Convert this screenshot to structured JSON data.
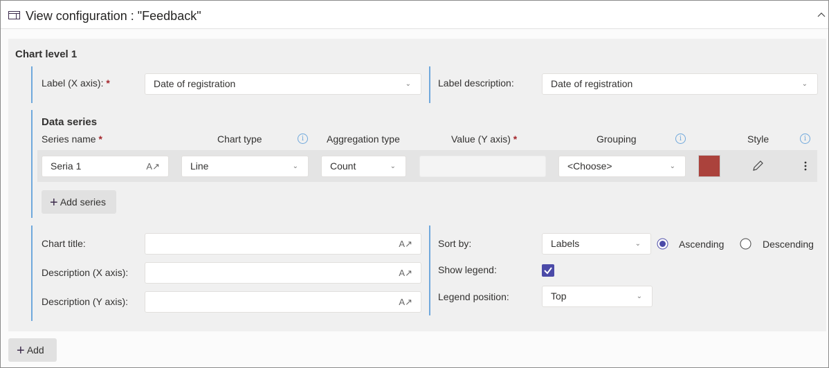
{
  "header": {
    "title": "View configuration : \"Feedback\"",
    "icon": "panel-icon",
    "collapse_icon": "chevron-up-icon"
  },
  "level": {
    "title": "Chart level 1",
    "label_x": {
      "label": "Label (X axis):",
      "required": "*",
      "value": "Date of registration"
    },
    "label_desc": {
      "label": "Label description:",
      "value": "Date of registration"
    }
  },
  "series": {
    "title": "Data series",
    "headers": {
      "name": "Series name",
      "chart_type": "Chart type",
      "aggregation": "Aggregation type",
      "value": "Value (Y axis)",
      "grouping": "Grouping",
      "style": "Style",
      "required": "*"
    },
    "rows": [
      {
        "name": "Seria 1",
        "chart_type": "Line",
        "aggregation": "Count",
        "value": "",
        "grouping": "<Choose>",
        "color": "#ab423c"
      }
    ],
    "add_label": "Add series"
  },
  "options": {
    "chart_title": {
      "label": "Chart title:",
      "value": ""
    },
    "desc_x": {
      "label": "Description (X axis):",
      "value": ""
    },
    "desc_y": {
      "label": "Description (Y axis):",
      "value": ""
    },
    "sort_by": {
      "label": "Sort by:",
      "value": "Labels",
      "ascending": "Ascending",
      "descending": "Descending",
      "selected": "Ascending"
    },
    "show_legend": {
      "label": "Show legend:",
      "checked": true
    },
    "legend_position": {
      "label": "Legend position:",
      "value": "Top"
    }
  },
  "add_label": "Add",
  "colors": {
    "accent": "#4b4aa8",
    "bar": "#6fa8dc",
    "swatch": "#ab423c"
  }
}
